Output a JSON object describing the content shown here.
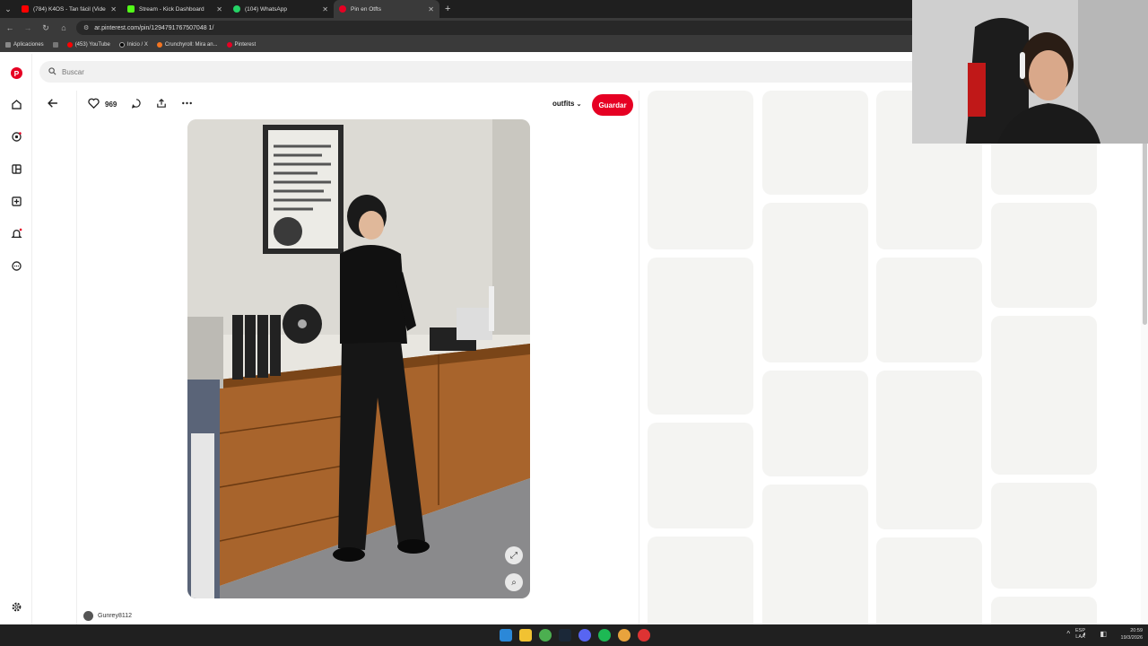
{
  "browser": {
    "tabs": [
      {
        "title": "(784) K4OS - Tan fácil (Video O",
        "color": "#ff0000"
      },
      {
        "title": "Stream - Kick Dashboard",
        "color": "#53fc18"
      },
      {
        "title": "(104) WhatsApp",
        "color": "#25d366"
      },
      {
        "title": "Pin en Otfts",
        "color": "#e60023"
      }
    ],
    "new_tab": "+",
    "url": "ar.pinterest.com/pin/1294791767507048 1/",
    "bookmarks": [
      {
        "label": "Aplicaciones",
        "color": "#888"
      },
      {
        "label": "(453) YouTube",
        "color": "#ff0000"
      },
      {
        "label": "Inicio / X",
        "color": "#000"
      },
      {
        "label": "Crunchyroll: Mira an...",
        "color": "#f47521"
      },
      {
        "label": "Pinterest",
        "color": "#e60023"
      }
    ]
  },
  "search": {
    "placeholder": "Buscar"
  },
  "pin": {
    "likes": "969",
    "board": "outfits",
    "save_label": "Guardar",
    "author": "Gunrey8112"
  },
  "taskbar": {
    "lang_1": "ESP",
    "lang_2": "LAA",
    "time": "20:59",
    "date": "19/3/2026"
  },
  "colors": {
    "brand": "#e60023",
    "skeleton": "#f4f4f2"
  }
}
